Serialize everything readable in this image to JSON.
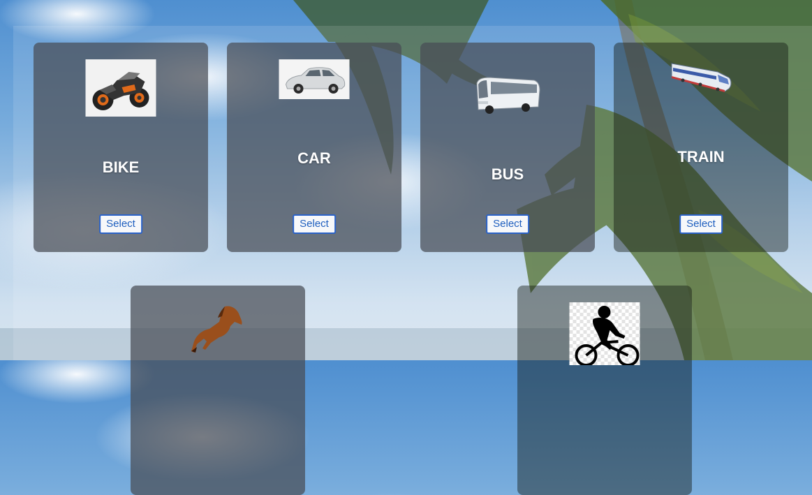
{
  "cards": [
    {
      "title": "BIKE",
      "button": "Select",
      "icon": "motorcycle-image"
    },
    {
      "title": "CAR",
      "button": "Select",
      "icon": "car-image"
    },
    {
      "title": "BUS",
      "button": "Select",
      "icon": "bus-image"
    },
    {
      "title": "TRAIN",
      "button": "Select",
      "icon": "train-image"
    },
    {
      "title": "",
      "button": "",
      "icon": "horse-image"
    },
    {
      "title": "",
      "button": "",
      "icon": "cyclist-silhouette-image"
    }
  ]
}
